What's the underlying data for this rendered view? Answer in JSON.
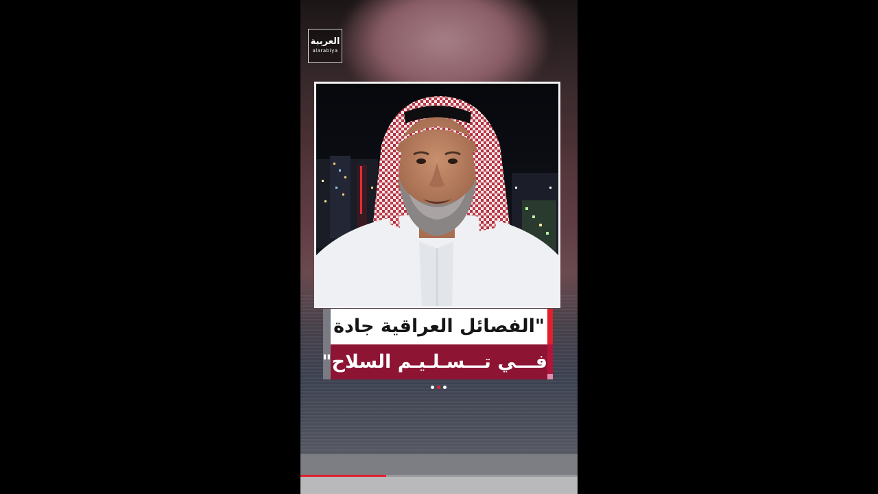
{
  "brand": {
    "logo_arabic": "العربية",
    "logo_latin": "alarabiya"
  },
  "caption": {
    "line1": "\"الفصائل العراقية جادة",
    "line2": "فـــي تـــسـلـيـم السلاح\""
  },
  "carousel": {
    "count": 3,
    "active_index": 1
  },
  "progress": {
    "fraction": 0.31
  },
  "colors": {
    "accent_red": "#e0212b",
    "caption_maroon": "#8e1434",
    "caption_white": "#ffffff"
  },
  "icons": {
    "logo": "alarabiya-logo-icon"
  }
}
